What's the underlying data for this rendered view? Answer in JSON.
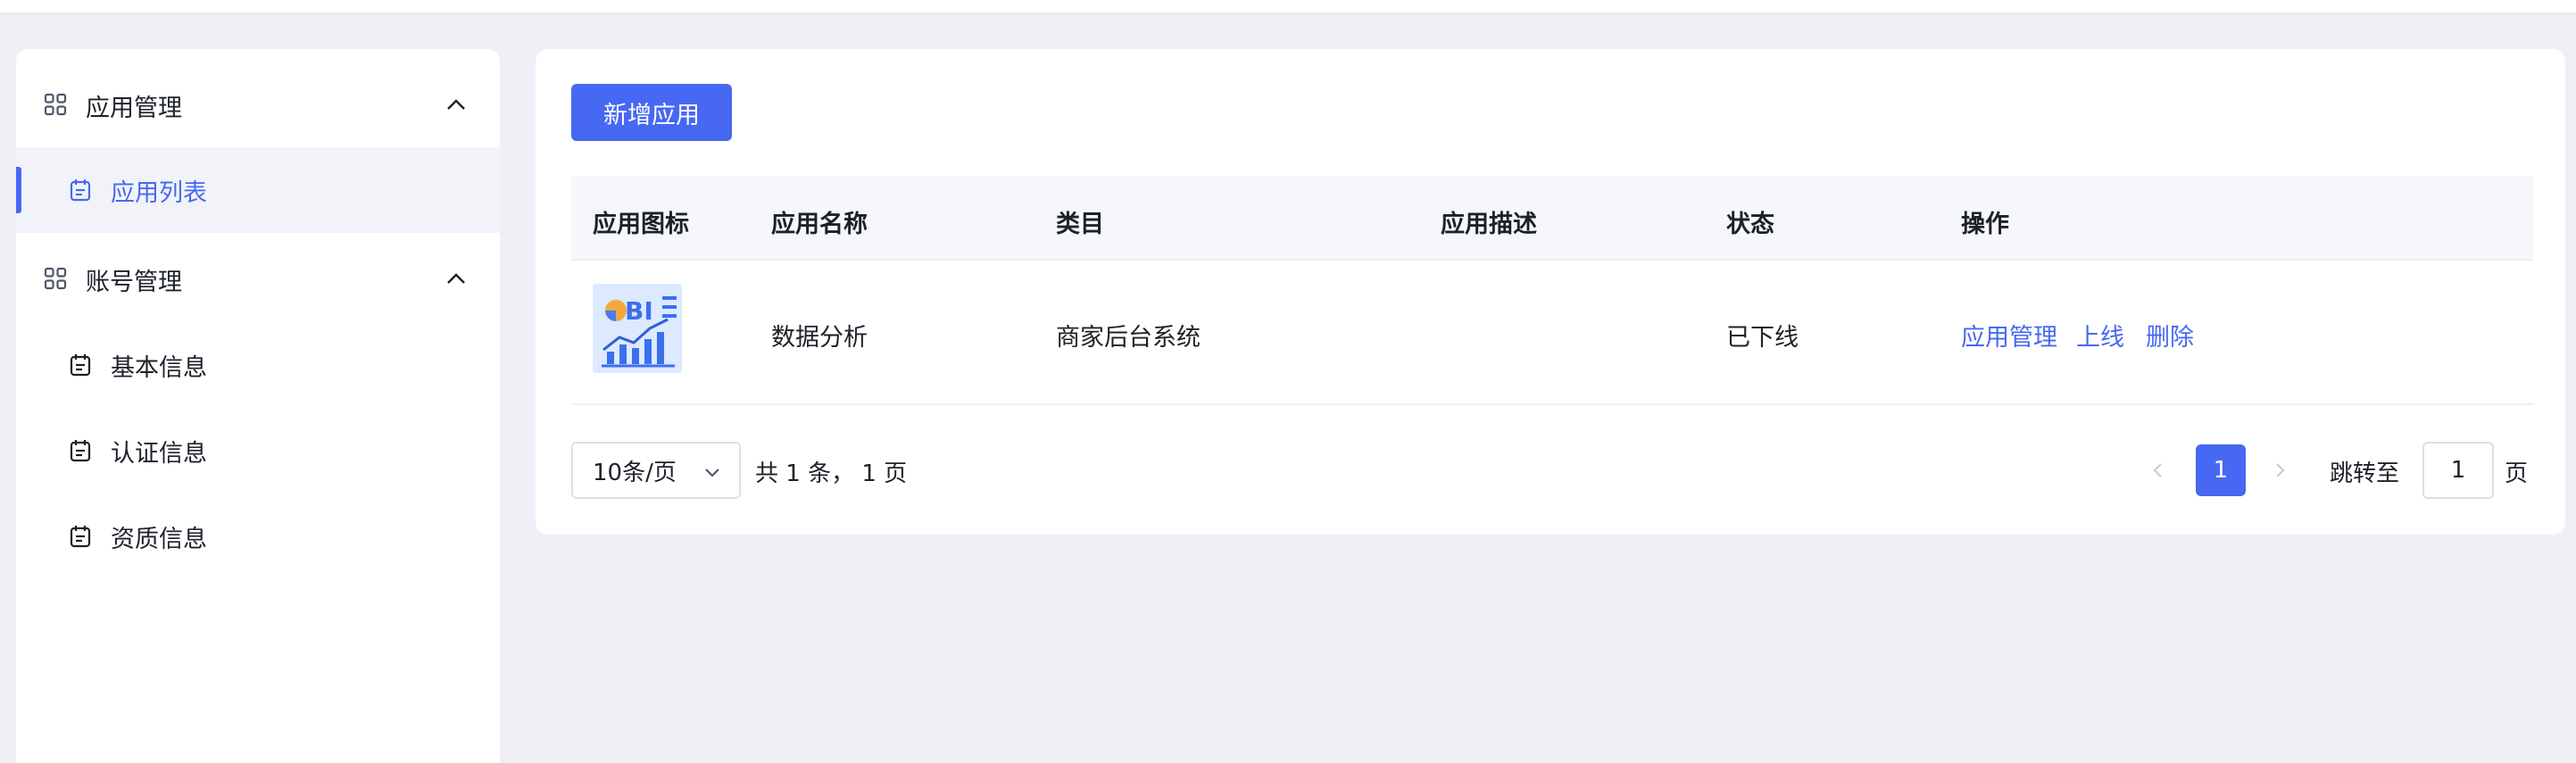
{
  "sidebar": {
    "groups": [
      {
        "label": "应用管理",
        "items": [
          {
            "label": "应用列表",
            "active": true
          }
        ]
      },
      {
        "label": "账号管理",
        "items": [
          {
            "label": "基本信息"
          },
          {
            "label": "认证信息"
          },
          {
            "label": "资质信息"
          }
        ]
      }
    ]
  },
  "main": {
    "add_button": "新增应用",
    "table": {
      "columns": [
        "应用图标",
        "应用名称",
        "类目",
        "应用描述",
        "状态",
        "操作"
      ],
      "rows": [
        {
          "icon_name": "bi-chart-icon",
          "icon_text": "BI",
          "name": "数据分析",
          "category": "商家后台系统",
          "description": "",
          "status": "已下线",
          "actions": [
            "应用管理",
            "上线",
            "删除"
          ]
        }
      ]
    },
    "pagination": {
      "page_size": "10条/页",
      "total": "共 1 条， 1 页",
      "current_page": "1",
      "jump_label": "跳转至",
      "jump_value": "1",
      "page_unit": "页"
    }
  },
  "colors": {
    "accent": "#4668f2",
    "background": "#eef0f6",
    "active_item_bg": "#f1f3f9",
    "table_header_bg": "#f6f7fb"
  }
}
